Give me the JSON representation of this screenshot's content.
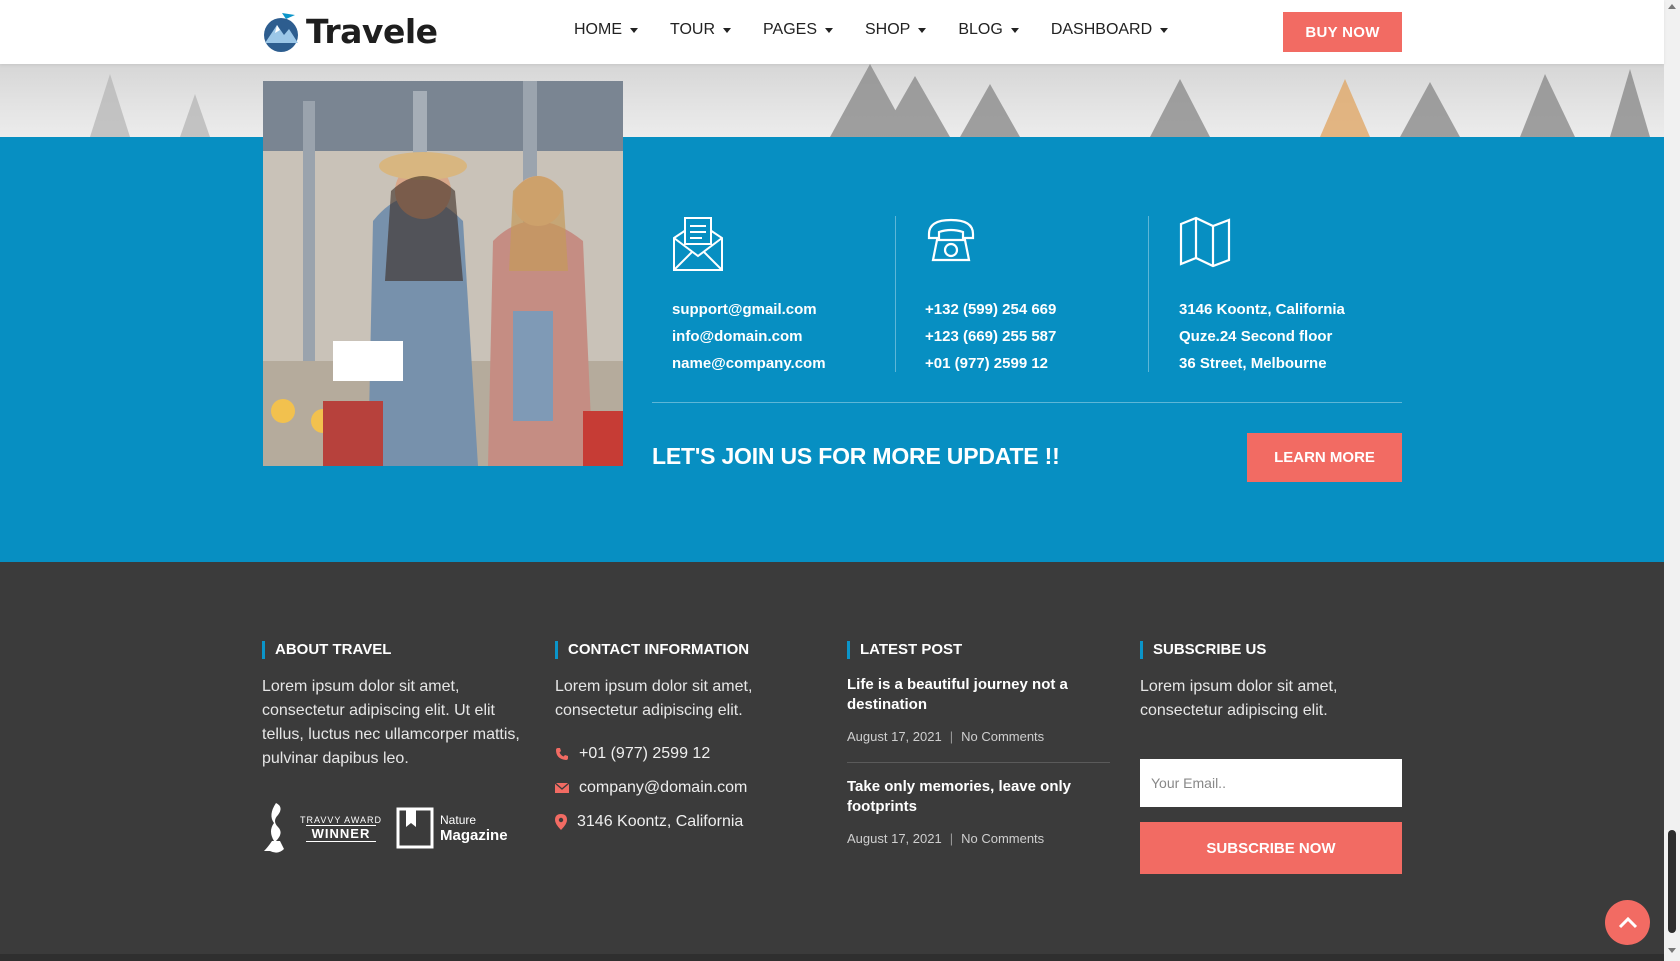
{
  "header": {
    "logo_text": "Travele",
    "nav": [
      {
        "label": "HOME"
      },
      {
        "label": "TOUR"
      },
      {
        "label": "PAGES"
      },
      {
        "label": "SHOP"
      },
      {
        "label": "BLOG"
      },
      {
        "label": "DASHBOARD"
      }
    ],
    "buy_label": "BUY NOW"
  },
  "contact_band": {
    "emails": [
      "support@gmail.com",
      "info@domain.com",
      "name@company.com"
    ],
    "phones": [
      "+132 (599) 254 669",
      "+123 (669) 255 587",
      "+01 (977) 2599 12"
    ],
    "address": [
      "3146 Koontz, California",
      "Quze.24 Second floor",
      "36 Street, Melbourne"
    ],
    "cta_text": "LET'S JOIN US FOR MORE UPDATE !!",
    "learn_label": "LEARN MORE",
    "icons": [
      "envelope-icon",
      "telephone-icon",
      "map-icon"
    ]
  },
  "footer": {
    "about": {
      "heading": "ABOUT TRAVEL",
      "text": "Lorem ipsum dolor sit amet, consectetur adipiscing elit. Ut elit tellus, luctus nec ullamcorper mattis, pulvinar dapibus leo.",
      "badge1_small": "TRAVVY AWARD",
      "badge1_big": "WINNER",
      "badge2_small": "Nature",
      "badge2_big": "Magazine"
    },
    "contact": {
      "heading": "CONTACT INFORMATION",
      "text": "Lorem ipsum dolor sit amet, consectetur adipiscing elit.",
      "phone": "+01 (977) 2599 12",
      "email": "company@domain.com",
      "address": "3146 Koontz, California"
    },
    "latest": {
      "heading": "LATEST POST",
      "posts": [
        {
          "title": "Life is a beautiful journey not a destination",
          "date": "August 17, 2021",
          "comments": "No Comments"
        },
        {
          "title": "Take only memories, leave only footprints",
          "date": "August 17, 2021",
          "comments": "No Comments"
        }
      ]
    },
    "subscribe": {
      "heading": "SUBSCRIBE US",
      "text": "Lorem ipsum dolor sit amet, consectetur adipiscing elit.",
      "placeholder": "Your Email..",
      "button": "SUBSCRIBE NOW"
    }
  },
  "colors": {
    "accent": "#f26b63",
    "blue": "#078fc2",
    "footer_bg": "#3b3b3b"
  }
}
